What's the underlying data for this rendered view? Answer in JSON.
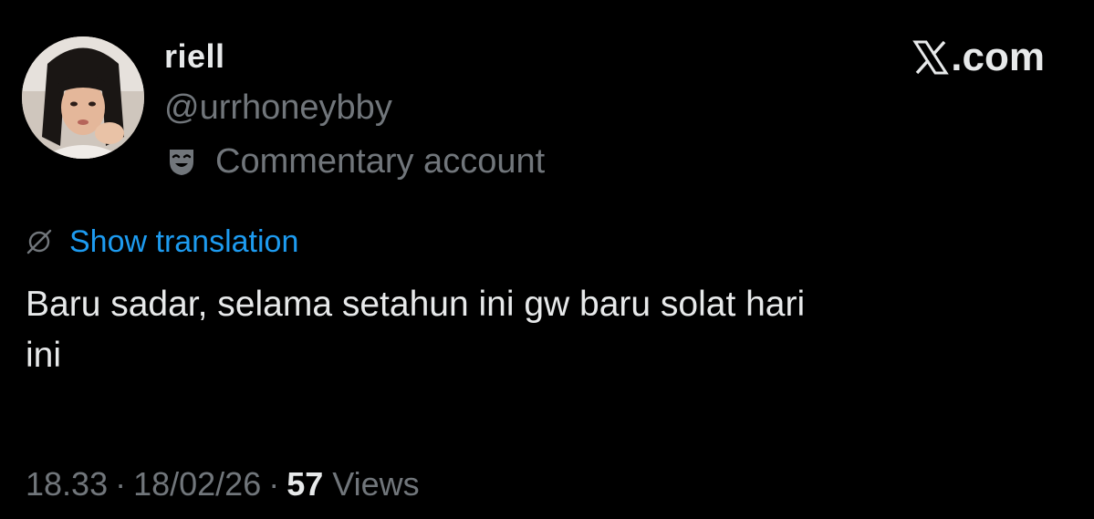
{
  "author": {
    "display_name": "riell",
    "handle": "@urrhoneybby",
    "label": "Commentary account",
    "label_icon": "theater-mask-icon",
    "avatar": "profile-photo"
  },
  "brand": {
    "name": "X.com",
    "rest": ".com",
    "icon": "x-logo-icon"
  },
  "translation": {
    "label": "Show translation",
    "icon": "globe-slash-icon",
    "color": "#1d9bf0"
  },
  "tweet": {
    "text": "Baru sadar, selama setahun ini gw baru solat hari\nini"
  },
  "meta": {
    "time": "18.33",
    "separator": "·",
    "date": "18/02/26",
    "views_count": "57",
    "views_label": "Views"
  },
  "colors": {
    "background": "#000000",
    "primary_text": "#e7e9ea",
    "secondary_text": "#71767b",
    "link": "#1d9bf0"
  }
}
